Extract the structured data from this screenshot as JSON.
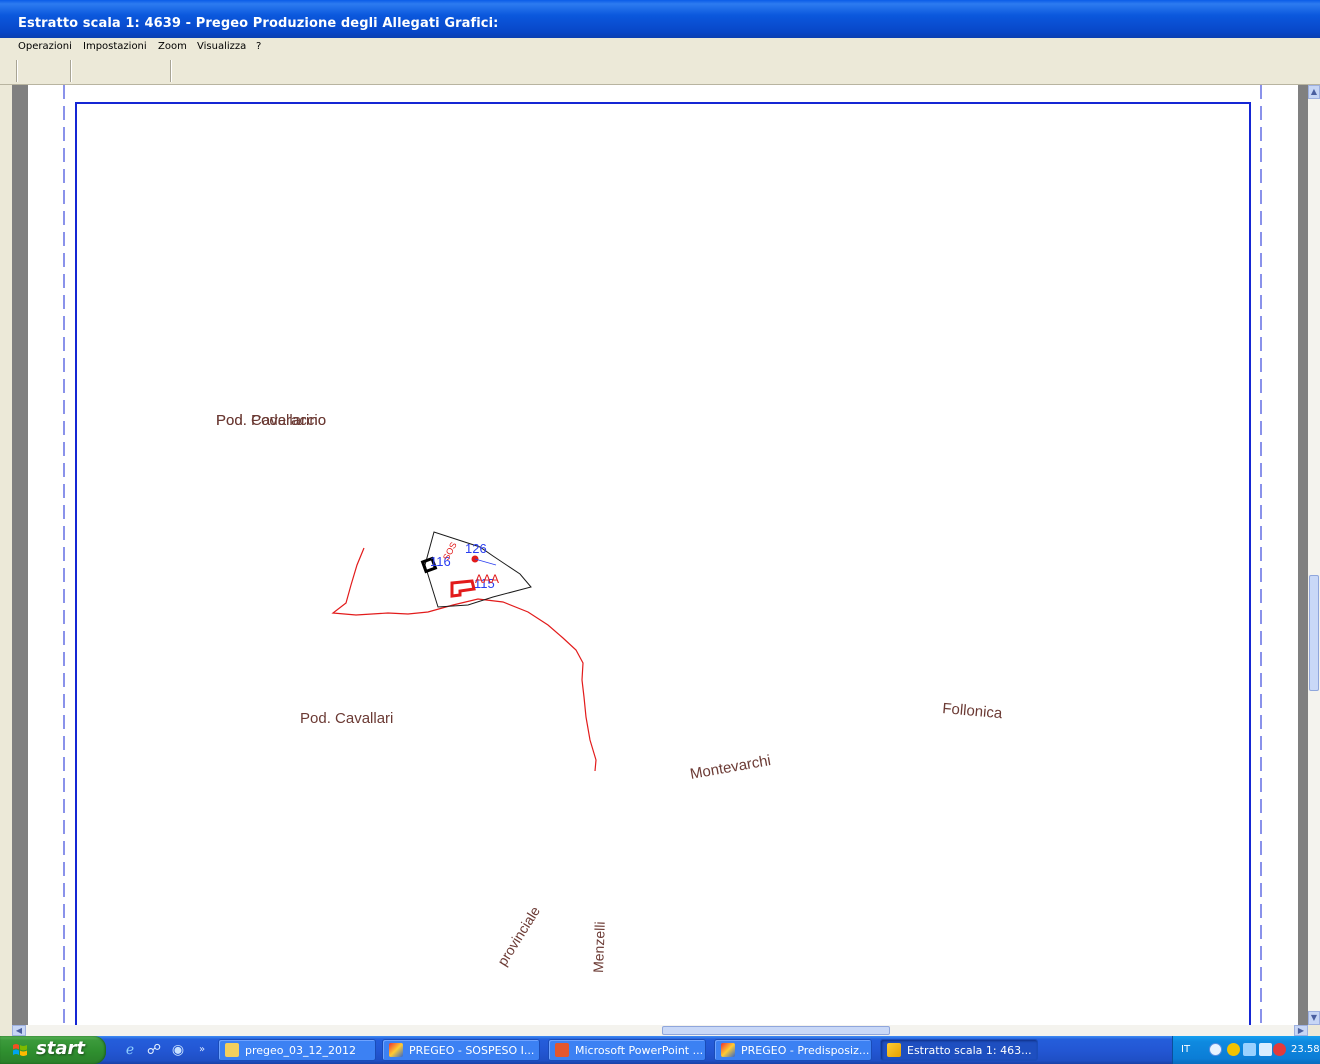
{
  "window": {
    "title": "Estratto scala 1:  4639 - Pregeo Produzione degli Allegati Grafici:"
  },
  "menu": {
    "items": [
      "Operazioni",
      "Impostazioni",
      "Zoom",
      "Visualizza",
      "?"
    ]
  },
  "map": {
    "labels": {
      "pod_overlap_a": "Pod. Poderaccio",
      "pod_overlap_b": "Pod. Cavallarino",
      "pod_cavallari": "Pod. Cavallari",
      "follonica": "Follonica",
      "montevarchi": "Montevarchi",
      "provinciale": "provinciale",
      "menzelli": "Menzelli"
    },
    "parcels": {
      "p126": "126",
      "p116": "116",
      "p115": "115",
      "p_red_a": "AAA",
      "p_red_b": "SOS"
    }
  },
  "taskbar": {
    "start_label": "start",
    "tasks": [
      "pregeo_03_12_2012",
      "PREGEO - SOSPESO I...",
      "Microsoft PowerPoint ...",
      "PREGEO - Predisposiz...",
      "Estratto scala 1: 463..."
    ],
    "tray": {
      "lang": "IT",
      "clock": "23.58"
    }
  },
  "colors": {
    "map_label": "#6b3a34",
    "parcel_number": "#2a3ef0",
    "red_feature": "#e21b1b",
    "sheet_border": "#1526d4"
  }
}
